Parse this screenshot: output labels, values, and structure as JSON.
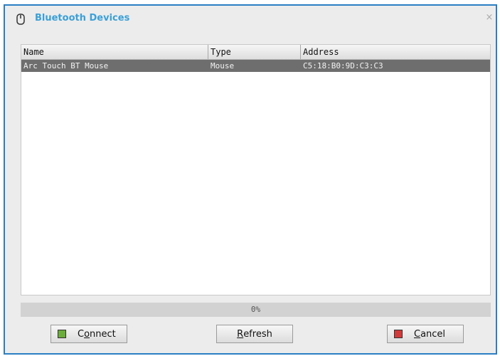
{
  "window": {
    "title": "Bluetooth Devices",
    "icon": "mouse-icon",
    "close_glyph": "×"
  },
  "device_list": {
    "columns": [
      "Name",
      "Type",
      "Address"
    ],
    "rows": [
      {
        "name": "Arc Touch BT Mouse",
        "type": "Mouse",
        "address": "C5:18:B0:9D:C3:C3",
        "selected": true
      }
    ]
  },
  "progress": {
    "label": "0%",
    "value": 0
  },
  "buttons": {
    "connect": {
      "mnemonic": "o",
      "rest": "nnect",
      "prefix": "C",
      "icon": "connect-icon"
    },
    "refresh": {
      "mnemonic": "R",
      "rest": "efresh",
      "icon": ""
    },
    "cancel": {
      "mnemonic": "C",
      "rest": "ancel",
      "icon": "cancel-icon"
    }
  },
  "colors": {
    "accent": "#3aa0d8",
    "border": "#2a7fc4",
    "selected_row": "#6e6e6e"
  }
}
